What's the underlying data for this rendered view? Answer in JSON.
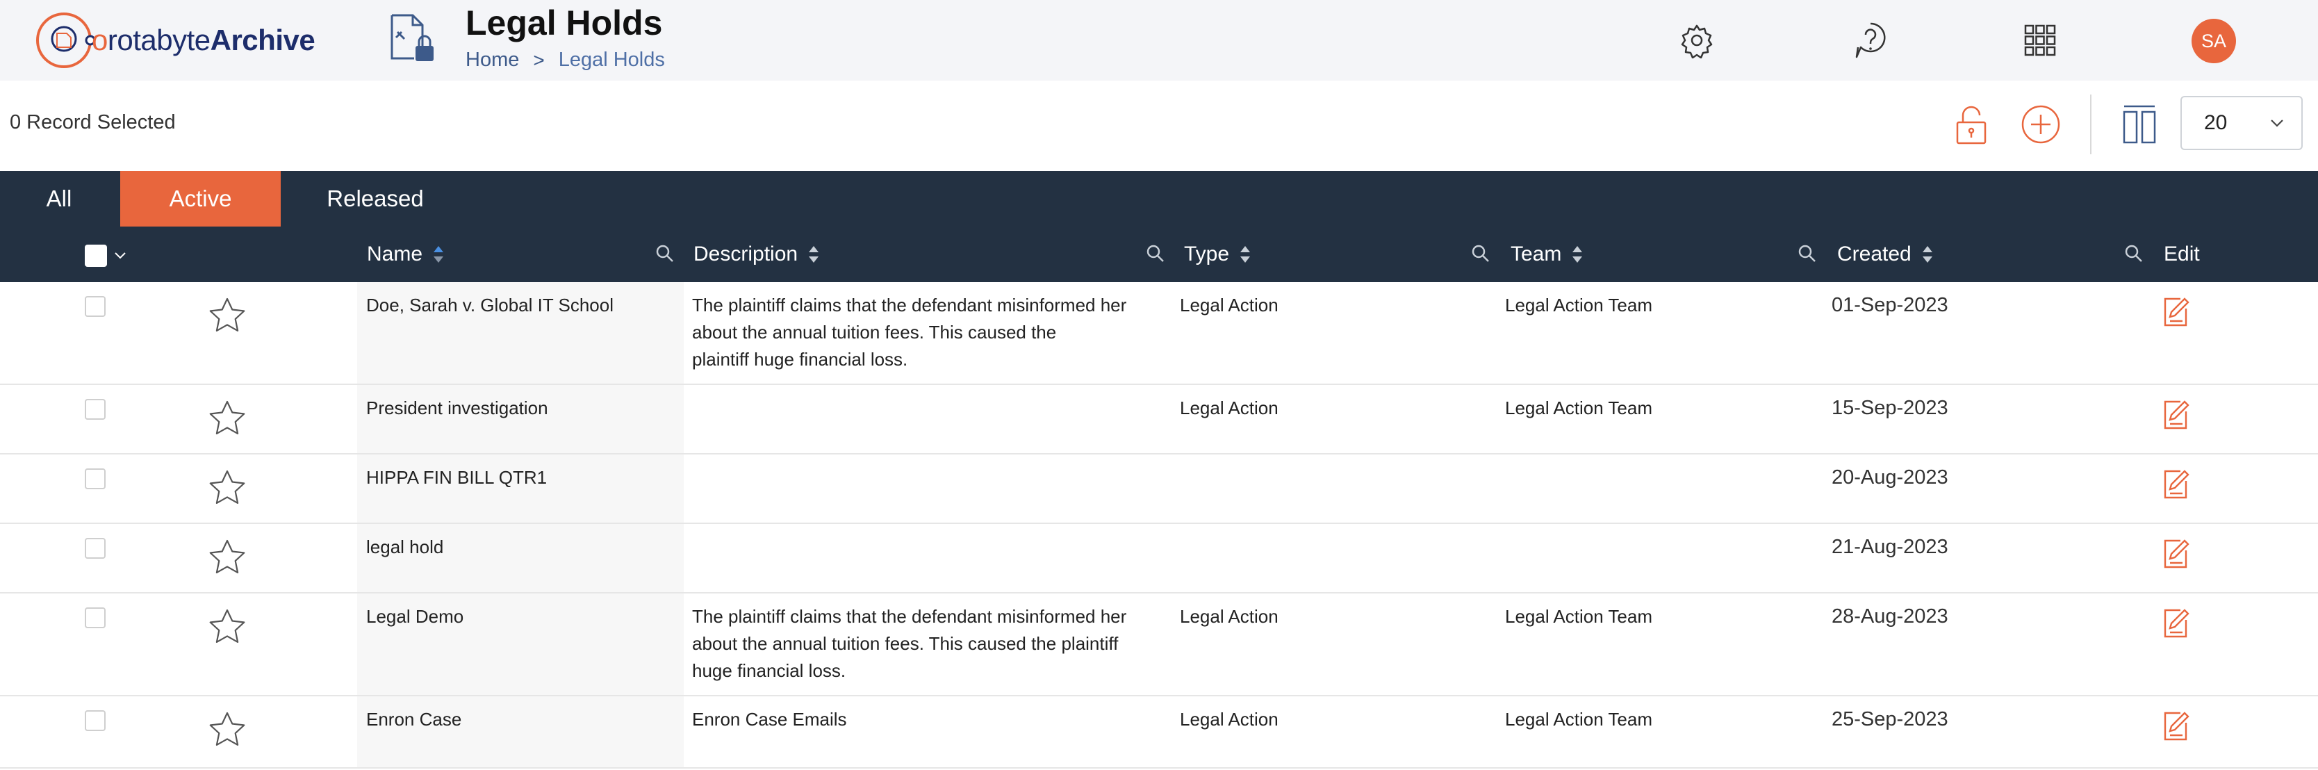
{
  "app": {
    "logo_o": "o",
    "logo_rest": "rotabyte",
    "logo_bold": "Archive"
  },
  "header": {
    "title": "Legal Holds",
    "breadcrumb": {
      "home": "Home",
      "separator": ">",
      "current": "Legal Holds"
    },
    "icons": [
      "settings-gear-icon",
      "help-question-icon",
      "apps-grid-icon"
    ],
    "avatar_initials": "SA"
  },
  "toolbar": {
    "selected_text": "0 Record Selected",
    "icons": [
      "unlock-icon",
      "add-circle-icon",
      "columns-icon"
    ],
    "page_size": "20"
  },
  "tabs": [
    {
      "label": "All",
      "active": false
    },
    {
      "label": "Active",
      "active": true
    },
    {
      "label": "Released",
      "active": false
    }
  ],
  "columns": {
    "name": "Name",
    "description": "Description",
    "type": "Type",
    "team": "Team",
    "created": "Created",
    "edit": "Edit"
  },
  "rows": [
    {
      "name": "Doe, Sarah v. Global IT School",
      "description_lines": [
        "The plaintiff claims that the defendant misinformed her",
        "about the annual tuition fees. This caused the",
        "plaintiff huge financial loss."
      ],
      "type": "Legal Action",
      "team": "Legal Action Team",
      "created": "01-Sep-2023"
    },
    {
      "name": "President investigation",
      "description_lines": [],
      "type": "Legal Action",
      "team": "Legal Action Team",
      "created": "15-Sep-2023"
    },
    {
      "name": "HIPPA FIN BILL QTR1",
      "description_lines": [],
      "type": "",
      "team": "",
      "created": "20-Aug-2023"
    },
    {
      "name": "legal hold",
      "description_lines": [],
      "type": "",
      "team": "",
      "created": "21-Aug-2023"
    },
    {
      "name": "Legal Demo",
      "description_lines": [
        "The plaintiff claims that the defendant misinformed her",
        "about the annual tuition fees. This caused the plaintiff",
        "huge financial loss."
      ],
      "type": "Legal Action",
      "team": "Legal Action Team",
      "created": "28-Aug-2023"
    },
    {
      "name": "Enron Case",
      "description_lines": [
        "Enron Case Emails"
      ],
      "type": "Legal Action",
      "team": "Legal Action Team",
      "created": "25-Sep-2023"
    }
  ],
  "colors": {
    "accent": "#e8663d",
    "dark_bar": "#233142",
    "brand_text": "#1d2d6b",
    "link": "#3d5a8a"
  }
}
